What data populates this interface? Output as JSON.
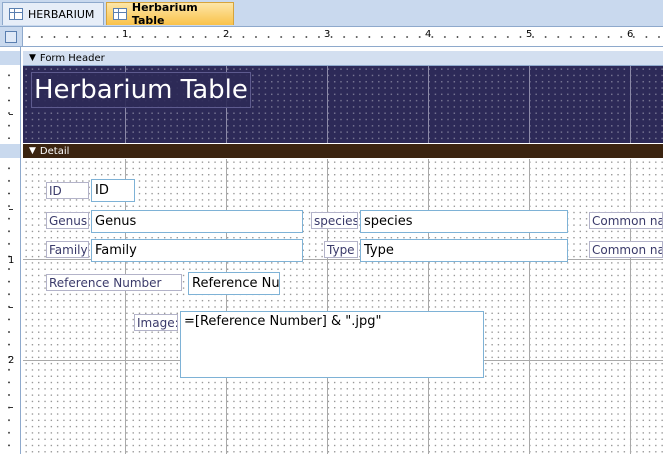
{
  "tabs": [
    {
      "label": "HERBARIUM",
      "active": false
    },
    {
      "label": "Herbarium Table",
      "active": true
    }
  ],
  "ruler": {
    "h_numbers": [
      "1",
      "2",
      "3",
      "4",
      "5",
      "6"
    ],
    "v_numbers": [
      "1",
      "2"
    ]
  },
  "sections": {
    "header": "Form Header",
    "detail": "Detail"
  },
  "form_title": "Herbarium Table",
  "controls": {
    "id": {
      "label": "ID",
      "field": "ID"
    },
    "genus": {
      "label": "Genus",
      "field": "Genus"
    },
    "species": {
      "label": "species",
      "field": "species"
    },
    "common1": {
      "label": "Common nam"
    },
    "family": {
      "label": "Family",
      "field": "Family"
    },
    "type": {
      "label": "Type",
      "field": "Type"
    },
    "common2": {
      "label": "Common nam"
    },
    "refnum": {
      "label": "Reference Number",
      "field": "Reference Nu"
    },
    "image": {
      "label": "Image:",
      "field": "=[Reference Number] & \".jpg\""
    }
  },
  "colors": {
    "header_bg": "#2d2a58",
    "detail_bar": "#3b2410",
    "active_tab": "#f9c24a",
    "field_border": "#7eb2d6"
  }
}
